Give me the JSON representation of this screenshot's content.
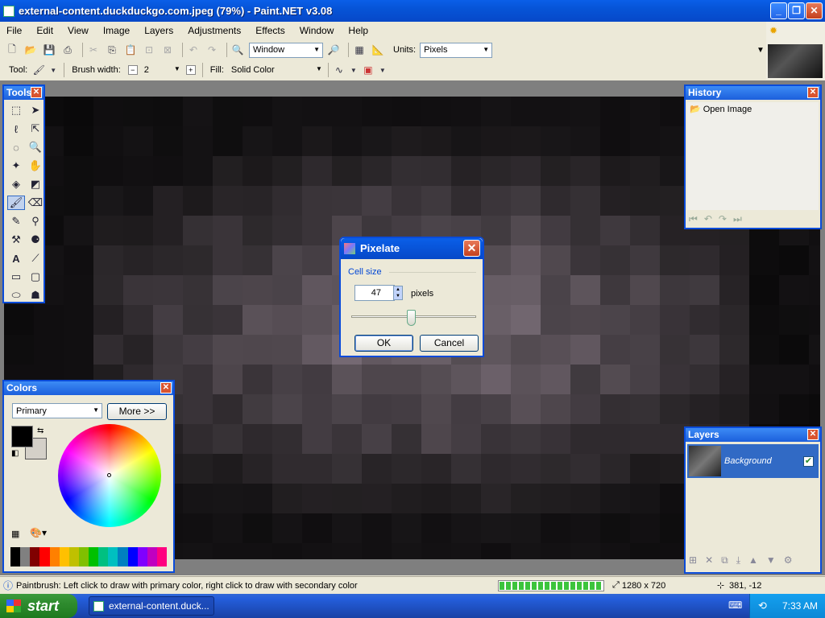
{
  "window": {
    "title": "external-content.duckduckgo.com.jpeg (79%) - Paint.NET v3.08"
  },
  "menu": [
    "File",
    "Edit",
    "View",
    "Image",
    "Layers",
    "Adjustments",
    "Effects",
    "Window",
    "Help"
  ],
  "toolbar": {
    "zoom_combo": "Window",
    "units_label": "Units:",
    "units_value": "Pixels",
    "tool_label": "Tool:",
    "brush_label": "Brush width:",
    "brush_value": "2",
    "fill_label": "Fill:",
    "fill_value": "Solid Color"
  },
  "panels": {
    "tools_title": "Tools",
    "history_title": "History",
    "history_items": [
      "Open Image"
    ],
    "colors_title": "Colors",
    "colors_primary": "Primary",
    "colors_more": "More >>",
    "layers_title": "Layers",
    "layer_name": "Background"
  },
  "dialog": {
    "title": "Pixelate",
    "group_label": "Cell size",
    "value": "47",
    "unit": "pixels",
    "slider_level": 0.47,
    "ok": "OK",
    "cancel": "Cancel"
  },
  "status": {
    "hint": "Paintbrush: Left click to draw with primary color, right click to draw with secondary color",
    "size": "1280 x 720",
    "coords": "381, -12"
  },
  "taskbar": {
    "start": "start",
    "task": "external-content.duck...",
    "clock": "7:33 AM"
  },
  "palette": [
    "#000000",
    "#808080",
    "#800000",
    "#ff0000",
    "#ff8000",
    "#ffc000",
    "#c0c000",
    "#80c000",
    "#00c000",
    "#00c080",
    "#00c0c0",
    "#0080c0",
    "#0000ff",
    "#8000ff",
    "#c000c0",
    "#ff0080"
  ]
}
